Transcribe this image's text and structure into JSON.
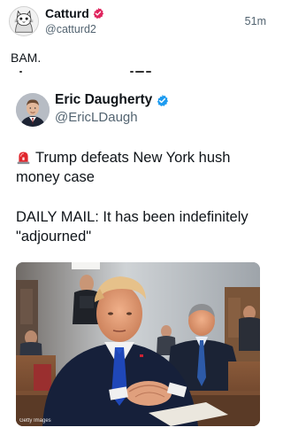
{
  "outer_tweet": {
    "author_name": "Catturd",
    "author_handle": "@catturd2",
    "time": "51m",
    "text": "BAM.",
    "verified_badge_color": "#e0245e"
  },
  "quoted_tweet": {
    "author_name": "Eric Daugherty",
    "author_handle": "@EricLDaugh",
    "verified_badge_color": "#1d9bf0",
    "headline_icon": "police-siren-icon",
    "headline_text": "Trump defeats New York hush money case",
    "body_text": "DAILY MAIL: It has been indefinitely \"adjourned\"",
    "photo": {
      "credit": "Getty Images"
    }
  },
  "colors": {
    "text_primary": "#0f1419",
    "text_secondary": "#536471"
  }
}
